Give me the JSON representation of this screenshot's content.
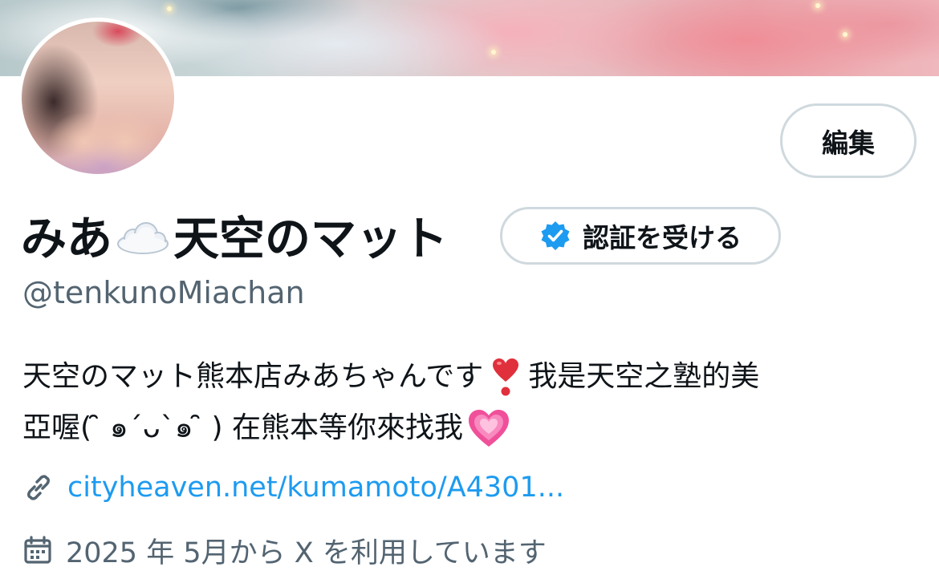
{
  "profile": {
    "display_name_part1": "みあ",
    "display_name_part2": "天空のマット",
    "handle": "@tenkunoMiachan",
    "edit_label": "編集",
    "verify_label": "認証を受ける",
    "bio_line1_part1": "天空のマット熊本店みあちゃんです",
    "bio_line1_part2": "我是天空之塾的美",
    "bio_line2_part1": "亞喔(  ̑̑ ๑´ᴗ`๑ ̑̑ ) 在熊本等你來找我",
    "link_text": "cityheaven.net/kumamoto/A4301...",
    "joined_text": "2025 年 5月から X を利用しています"
  },
  "icons": {
    "cloud": "cloud-emoji",
    "verified": "verified-badge-icon",
    "exclamation_heart": "heart-exclamation-emoji",
    "pink_heart": "growing-heart-emoji",
    "link": "link-icon",
    "calendar": "calendar-icon"
  },
  "colors": {
    "accent": "#1d9bf0",
    "secondary_text": "#536471",
    "border": "#cfd9de",
    "primary_text": "#0f1419"
  }
}
